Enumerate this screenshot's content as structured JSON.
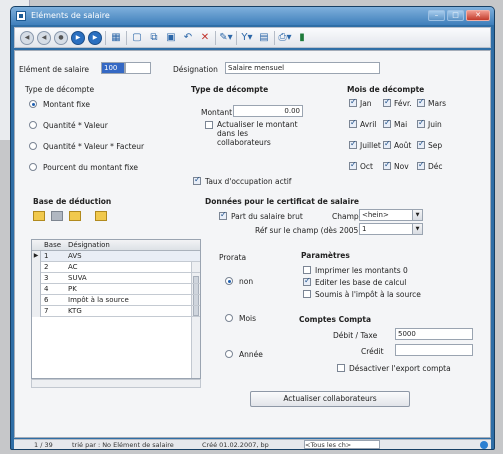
{
  "window": {
    "title": "Eléments de salaire"
  },
  "toolbar": {
    "icons": [
      "first-icon",
      "prev-icon",
      "play-icon",
      "next-icon",
      "last-icon",
      "grid-icon",
      "new-icon",
      "copy-icon",
      "save-icon",
      "undo-icon",
      "delete-icon",
      "tools-icon",
      "filter-icon",
      "book-icon",
      "print-icon",
      "excel-icon"
    ]
  },
  "header": {
    "element_label": "Elément de salaire",
    "element_value": "100",
    "designation_label": "Désignation",
    "designation_value": "Salaire mensuel"
  },
  "type_decompte": {
    "title": "Type de décompte",
    "options": [
      "Montant fixe",
      "Quantité * Valeur",
      "Quantité * Valeur * Facteur",
      "Pourcent du montant fixe"
    ],
    "selected": 0
  },
  "type_decompte2": {
    "title": "Type de décompte",
    "montant_label": "Montant",
    "montant_value": "0.00",
    "actualiser_label": "Actualiser le montant dans les collaborateurs",
    "taux_label": "Taux d'occupation actif"
  },
  "mois": {
    "title": "Mois de décompte",
    "months": [
      "Jan",
      "Févr.",
      "Mars",
      "Avril",
      "Mai",
      "Juin",
      "Juillet",
      "Août",
      "Sep",
      "Oct",
      "Nov",
      "Déc"
    ]
  },
  "base": {
    "title": "Base de déduction",
    "columns": [
      "Base",
      "Désignation"
    ],
    "rows": [
      {
        "base": "1",
        "designation": "AVS"
      },
      {
        "base": "2",
        "designation": "AC"
      },
      {
        "base": "3",
        "designation": "SUVA"
      },
      {
        "base": "4",
        "designation": "PK"
      },
      {
        "base": "6",
        "designation": "Impôt à la source"
      },
      {
        "base": "7",
        "designation": "KTG"
      }
    ]
  },
  "certificat": {
    "title": "Données pour le certificat de salaire",
    "part_label": "Part du salaire brut",
    "champ_label": "Champ",
    "champ_value": "<hein>",
    "ref_label": "Réf sur le champ (dès 2005)",
    "ref_value": "1"
  },
  "prorata": {
    "title": "Prorata",
    "options": [
      "non",
      "Mois",
      "Année"
    ],
    "selected": 0
  },
  "parametres": {
    "title": "Paramètres",
    "items": [
      {
        "label": "Imprimer les montants 0",
        "checked": false
      },
      {
        "label": "Editer les base de calcul",
        "checked": true
      },
      {
        "label": "Soumis à l'impôt à la source",
        "checked": false
      }
    ]
  },
  "comptes": {
    "title": "Comptes Compta",
    "debit_label": "Débit / Taxe",
    "debit_value": "5000",
    "credit_label": "Crédit",
    "credit_value": "",
    "desactiver_label": "Désactiver l'export compta"
  },
  "button": {
    "actualiser": "Actualiser collaborateurs"
  },
  "status": {
    "record": "1 / 39",
    "tri": "trié par : No Elément de salaire",
    "cree": "Créé 01.02.2007, bp",
    "filter": "<Tous les ch>"
  }
}
